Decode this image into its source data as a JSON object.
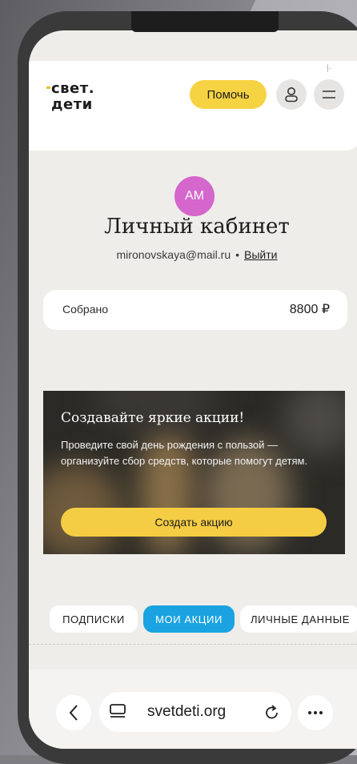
{
  "header": {
    "logo_line1": "свет.",
    "logo_line2": "дети",
    "help_button": "Помочь",
    "profile_icon": "user-icon",
    "menu_icon": "menu-icon"
  },
  "profile": {
    "avatar_initials": "AM",
    "title": "Личный кабинет",
    "email": "mironovskaya@mail.ru",
    "separator": "•",
    "logout": "Выйти"
  },
  "collected": {
    "label": "Собрано",
    "value": "8800 ₽"
  },
  "promo": {
    "title": "Создавайте яркие акции!",
    "text": "Проведите свой день рождения с пользой — организуйте сбор средств, которые помогут детям.",
    "button": "Создать акцию"
  },
  "tabs": [
    {
      "label": "ПОДПИСКИ",
      "active": false
    },
    {
      "label": "МОИ АКЦИИ",
      "active": true
    },
    {
      "label": "ЛИЧНЫЕ ДАННЫЕ",
      "active": false
    }
  ],
  "browser": {
    "url": "svetdeti.org",
    "back_icon": "chevron-left-icon",
    "tabs_icon": "tabs-icon",
    "reload_icon": "reload-icon",
    "more_icon": "more-icon"
  },
  "colors": {
    "accent_yellow": "#f6d343",
    "accent_blue": "#1aa3e0",
    "avatar_pink": "#d466cc"
  }
}
